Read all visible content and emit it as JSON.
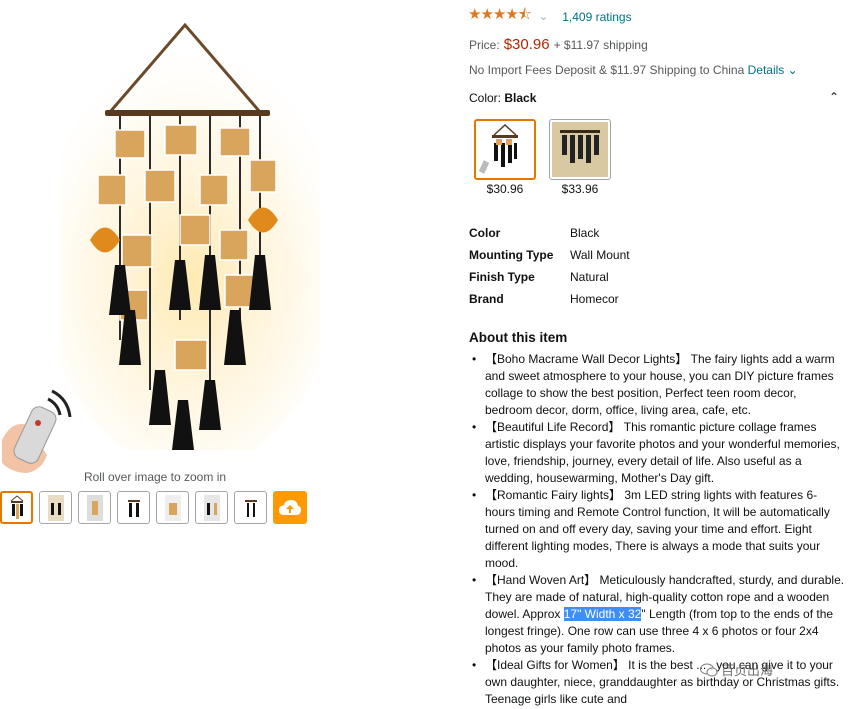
{
  "gallery": {
    "zoom_hint": "Roll over image to zoom in",
    "thumbnail_count": 7
  },
  "rating": {
    "stars": 4.5,
    "count_label": "1,409 ratings"
  },
  "price": {
    "label": "Price:",
    "amount": "$30.96",
    "shipping": "+ $11.97 shipping"
  },
  "import_fees": {
    "text": "No Import Fees Deposit & $11.97 Shipping to China",
    "details_link": "Details"
  },
  "color": {
    "label": "Color:",
    "selected": "Black",
    "options": [
      {
        "price": "$30.96"
      },
      {
        "price": "$33.96"
      }
    ]
  },
  "specs": [
    {
      "key": "Color",
      "value": "Black"
    },
    {
      "key": "Mounting Type",
      "value": "Wall Mount"
    },
    {
      "key": "Finish Type",
      "value": "Natural"
    },
    {
      "key": "Brand",
      "value": "Homecor"
    }
  ],
  "about": {
    "title": "About this item",
    "bullets": [
      "【Boho Macrame Wall Decor Lights】 The fairy lights add a warm and sweet atmosphere to your house, you can DIY picture frames collage to show the best position, Perfect teen room decor, bedroom decor, dorm, office, living area, cafe, etc.",
      "【Beautiful Life Record】 This romantic picture collage frames artistic displays your favorite photos and your wonderful memories, love, friendship, journey, every detail of life. Also useful as a wedding, housewarming, Mother's Day gift.",
      "【Romantic Fairy lights】 3m LED string lights with features 6-hours timing and Remote Control function, It will be automatically turned on and off every day, saving your time and effort. Eight different lighting modes, There is always a mode that suits your mood.",
      {
        "before": "【Hand Woven Art】 Meticulously handcrafted, sturdy, and durable. They are made of natural, high-quality cotton rope and a wooden dowel. Approx ",
        "highlight": "17\" Width x 32",
        "after": "\" Length (from top to the ends of the longest fringe). One row can use three 4 x 6 photos or four 2x4 photos as your family photo frames."
      },
      "【Ideal Gifts for Women】 It is the best ... , you can give it to your own daughter, niece, granddaughter as birthday or Christmas gifts. Teenage girls like cute and"
    ]
  },
  "watermark": "百贞出海"
}
